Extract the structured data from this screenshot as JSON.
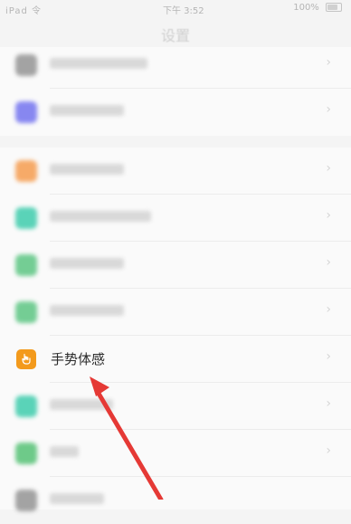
{
  "status_bar": {
    "carrier": "iPad 令",
    "time": "下午 3:52",
    "battery": "100%"
  },
  "header": {
    "title": "设置"
  },
  "rows": [
    {
      "id": "partial-top",
      "label": "",
      "icon_color": "#9a9a9a"
    },
    {
      "id": "row-purple",
      "label": "",
      "icon_color": "#7b7bf0"
    },
    {
      "id": "row-orange",
      "label": "",
      "icon_color": "#f6a259"
    },
    {
      "id": "row-teal",
      "label": "",
      "icon_color": "#49cfb1"
    },
    {
      "id": "row-green-1",
      "label": "",
      "icon_color": "#66c98a"
    },
    {
      "id": "row-green-2",
      "label": "",
      "icon_color": "#66c98a"
    },
    {
      "id": "gesture",
      "label": "手势体感",
      "icon_color": "#f39a1c",
      "icon": "hand-icon"
    },
    {
      "id": "row-teal-2",
      "label": "",
      "icon_color": "#49cfb1"
    },
    {
      "id": "row-green-3",
      "label": "",
      "icon_color": "#5fc57d"
    },
    {
      "id": "row-gray-bottom",
      "label": "",
      "icon_color": "#9a9a9a"
    }
  ],
  "annotation": {
    "color": "#e53935"
  },
  "chevron_glyph": "›"
}
